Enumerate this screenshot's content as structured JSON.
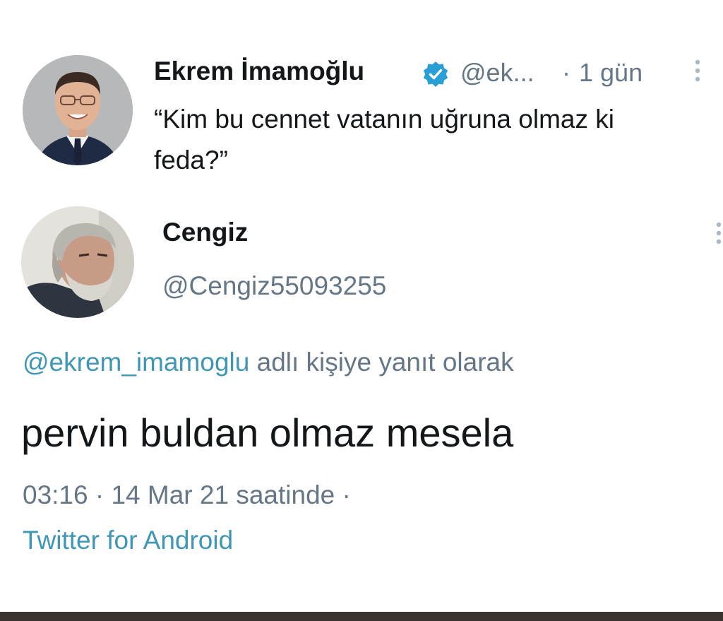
{
  "parent_tweet": {
    "author_name": "Ekrem İmamoğlu",
    "author_handle": "@ek...",
    "separator": "·",
    "time": "1 gün",
    "text": "“Kim bu cennet vatanın uğruna olmaz ki feda?”",
    "verified_icon": "verified-badge-icon",
    "more_icon": "more-vertical-icon"
  },
  "reply_tweet": {
    "author_name": "Cengiz",
    "author_handle": "@Cengiz55093255",
    "replying_mention": "@ekrem_imamoglu",
    "replying_suffix": " adlı kişiye yanıt olarak",
    "text": "pervin buldan olmaz mesela",
    "timestamp": "03:16 · 14 Mar 21 saatinde ·",
    "source": "Twitter for Android",
    "more_icon": "more-vertical-icon"
  },
  "colors": {
    "link": "#3f97b5",
    "muted": "#657786",
    "text": "#14171a",
    "verified": "#1da1f2"
  }
}
